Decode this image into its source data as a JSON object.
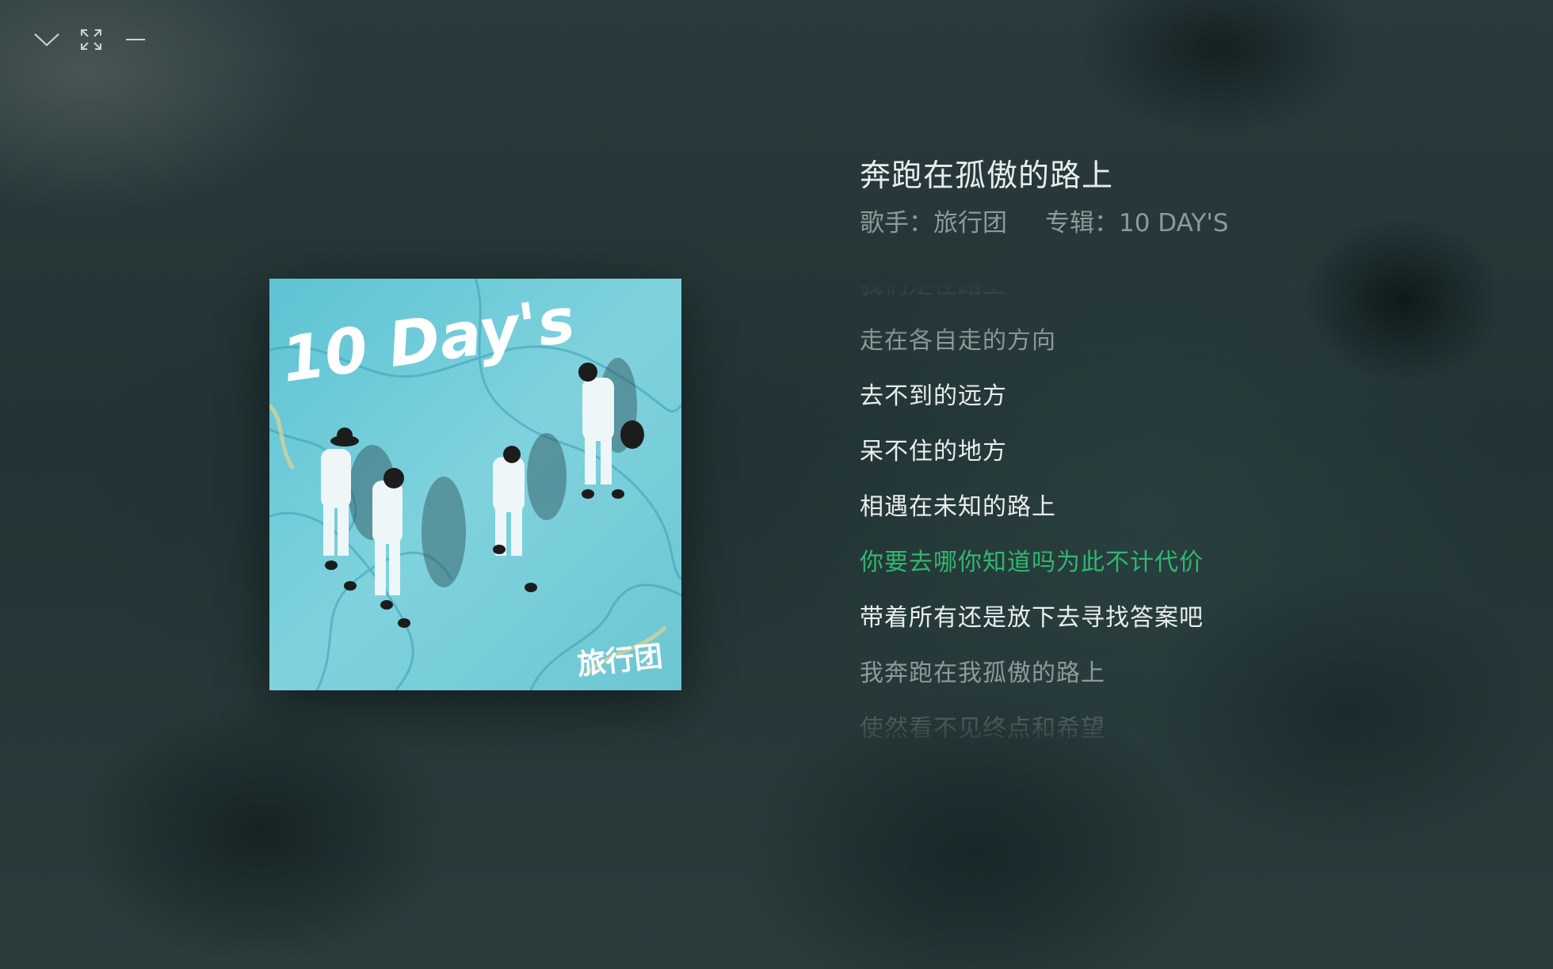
{
  "song": {
    "title": "奔跑在孤傲的路上",
    "artist_label": "歌手：旅行团",
    "album_label": "专辑：10 DAY'S"
  },
  "cover": {
    "title_text": "10 Day's",
    "band_text": "旅行团"
  },
  "window_controls": [
    "chevron-down-icon",
    "fullscreen-icon",
    "minimize-icon"
  ],
  "lyrics": {
    "lines": [
      {
        "text": "我们走在路上",
        "state": "faded"
      },
      {
        "text": "走在各自走的方向",
        "state": "dim"
      },
      {
        "text": "去不到的远方",
        "state": "normal"
      },
      {
        "text": "呆不住的地方",
        "state": "normal"
      },
      {
        "text": "相遇在未知的路上",
        "state": "normal"
      },
      {
        "text": "你要去哪你知道吗为此不计代价",
        "state": "current"
      },
      {
        "text": "带着所有还是放下去寻找答案吧",
        "state": "normal"
      },
      {
        "text": "我奔跑在我孤傲的路上",
        "state": "dim"
      },
      {
        "text": "使然看不见终点和希望",
        "state": "faded"
      }
    ]
  },
  "colors": {
    "current_line": "#2fb86e",
    "normal_line": "#e8eeee",
    "dim_line": "#8e9a9a",
    "faded_line": "#6d7b7b"
  }
}
